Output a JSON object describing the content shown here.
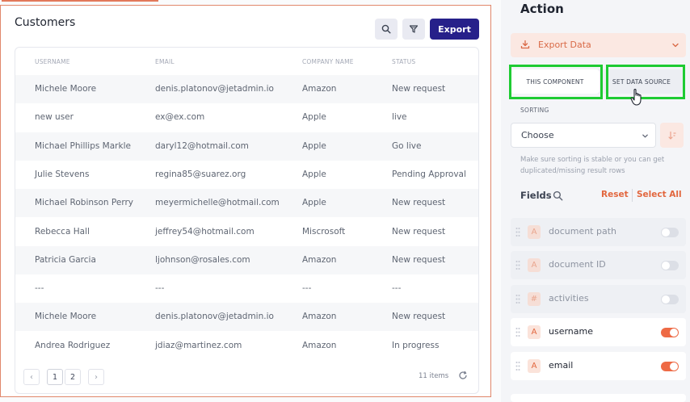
{
  "customers": {
    "title": "Customers",
    "export_label": "Export",
    "columns": [
      "USERNAME",
      "EMAIL",
      "COMPANY NAME",
      "STATUS"
    ],
    "rows": [
      [
        "Michele Moore",
        "denis.platonov@jetadmin.io",
        "Amazon",
        "New request"
      ],
      [
        "new user",
        "ex@ex.com",
        "Apple",
        "live"
      ],
      [
        "Michael Phillips Markle",
        "daryl12@hotmail.com",
        "Apple",
        "Go live"
      ],
      [
        "Julie Stevens",
        "regina85@suarez.org",
        "Apple",
        "Pending Approval"
      ],
      [
        "Michael Robinson Perry",
        "meyermichelle@hotmail.com",
        "Apple",
        "New request"
      ],
      [
        "Rebecca Hall",
        "jeffrey54@hotmail.com",
        "Miscrosoft",
        "New request"
      ],
      [
        "Patricia Garcia",
        "ljohnson@rosales.com",
        "Amazon",
        "New request"
      ],
      [
        "---",
        "---",
        "---",
        "---"
      ],
      [
        "Michele Moore",
        "denis.platonov@jetadmin.io",
        "Amazon",
        "New request"
      ],
      [
        "Andrea Rodriguez",
        "jdiaz@martinez.com",
        "Amazon",
        "In progress"
      ]
    ],
    "pagination": {
      "prev": "‹",
      "next": "›",
      "pages": [
        "1",
        "2"
      ],
      "active_page": "1",
      "count": "11 items"
    }
  },
  "action": {
    "title": "Action",
    "export_data_label": "Export Data",
    "tabs": [
      "THIS COMPONENT",
      "SET DATA SOURCE"
    ],
    "sorting_label": "SORTING",
    "sorting_value": "Choose",
    "sorting_help": "Make sure sorting is stable or you can get duplicated/missing result rows",
    "fields_label": "Fields",
    "reset_label": "Reset",
    "select_all_label": "Select All",
    "fields": [
      {
        "name": "document path",
        "type": "A",
        "enabled": false
      },
      {
        "name": "document ID",
        "type": "A",
        "enabled": false
      },
      {
        "name": "activities",
        "type": "#",
        "enabled": false
      },
      {
        "name": "username",
        "type": "A",
        "enabled": true
      },
      {
        "name": "email",
        "type": "A",
        "enabled": true
      }
    ]
  },
  "colors": {
    "accent": "#26208a",
    "orange": "#e2673f",
    "highlight": "#1ecb32"
  }
}
